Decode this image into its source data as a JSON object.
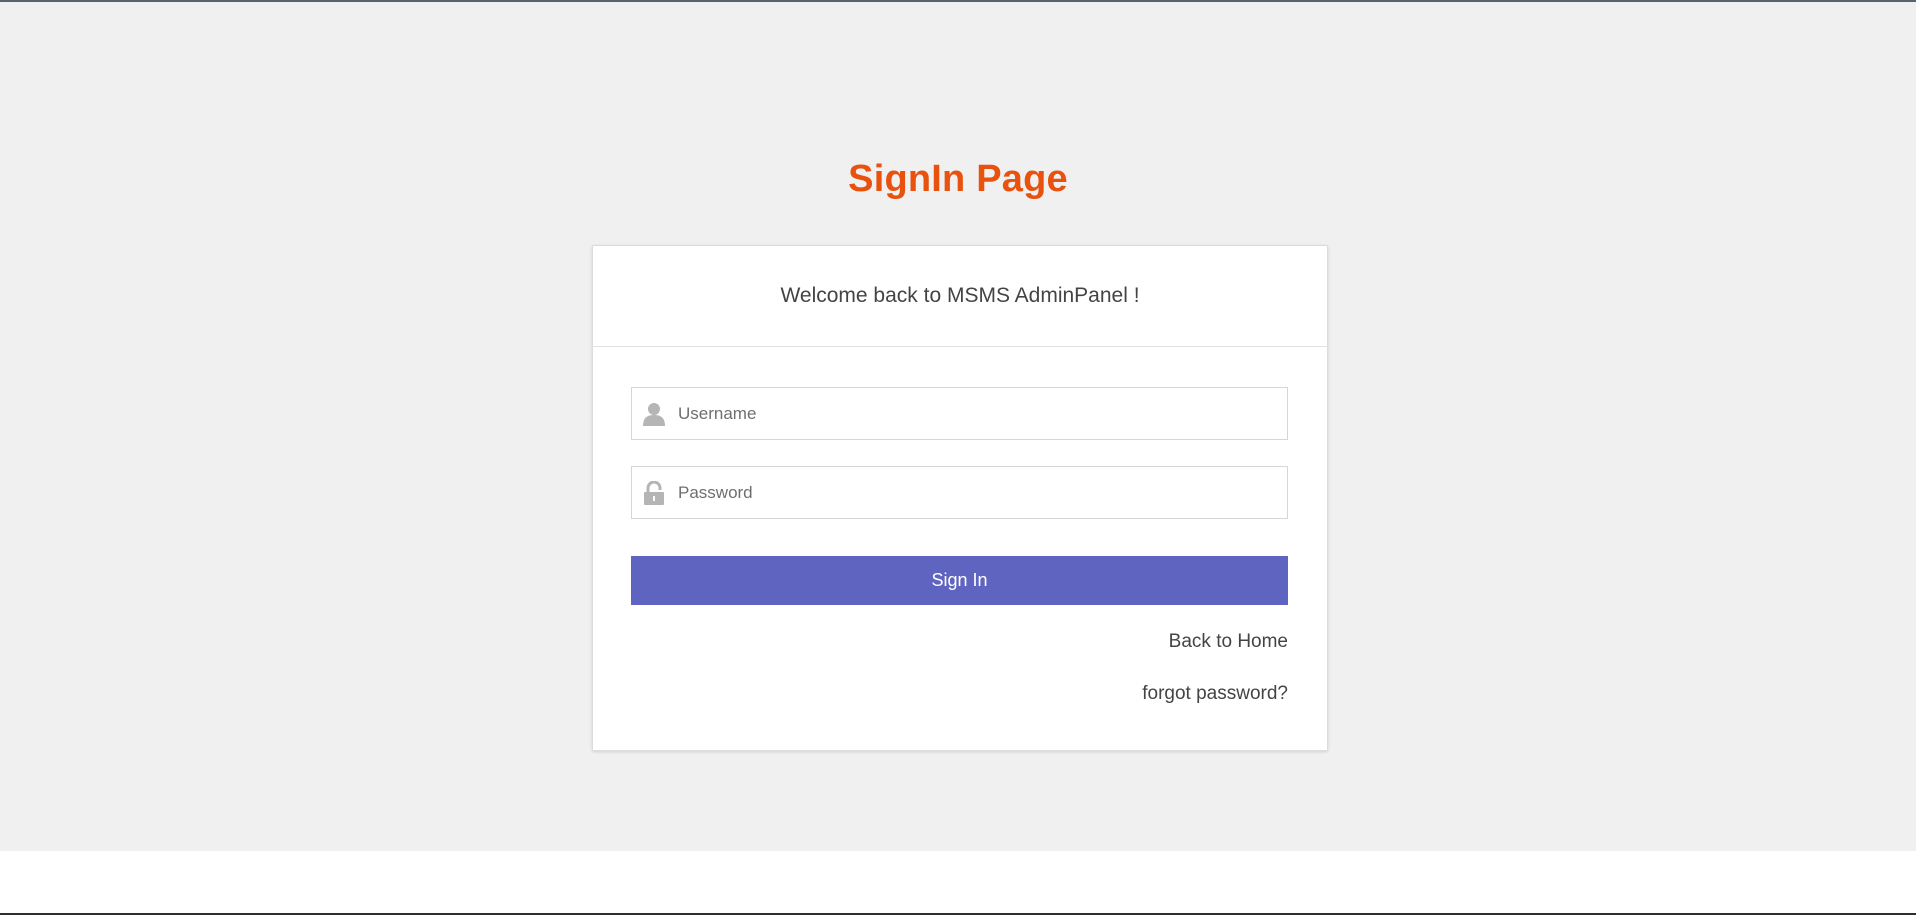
{
  "page": {
    "title": "SignIn Page"
  },
  "card": {
    "welcome": "Welcome back to MSMS AdminPanel !"
  },
  "form": {
    "username_placeholder": "Username",
    "username_icon": "user-icon",
    "password_placeholder": "Password",
    "password_icon": "lock-icon",
    "signin_label": "Sign In"
  },
  "links": {
    "back_home": "Back to Home",
    "forgot_password": "forgot password?"
  },
  "colors": {
    "title": "#e8510e",
    "button": "#6064c1",
    "background": "#f0f0f0"
  }
}
